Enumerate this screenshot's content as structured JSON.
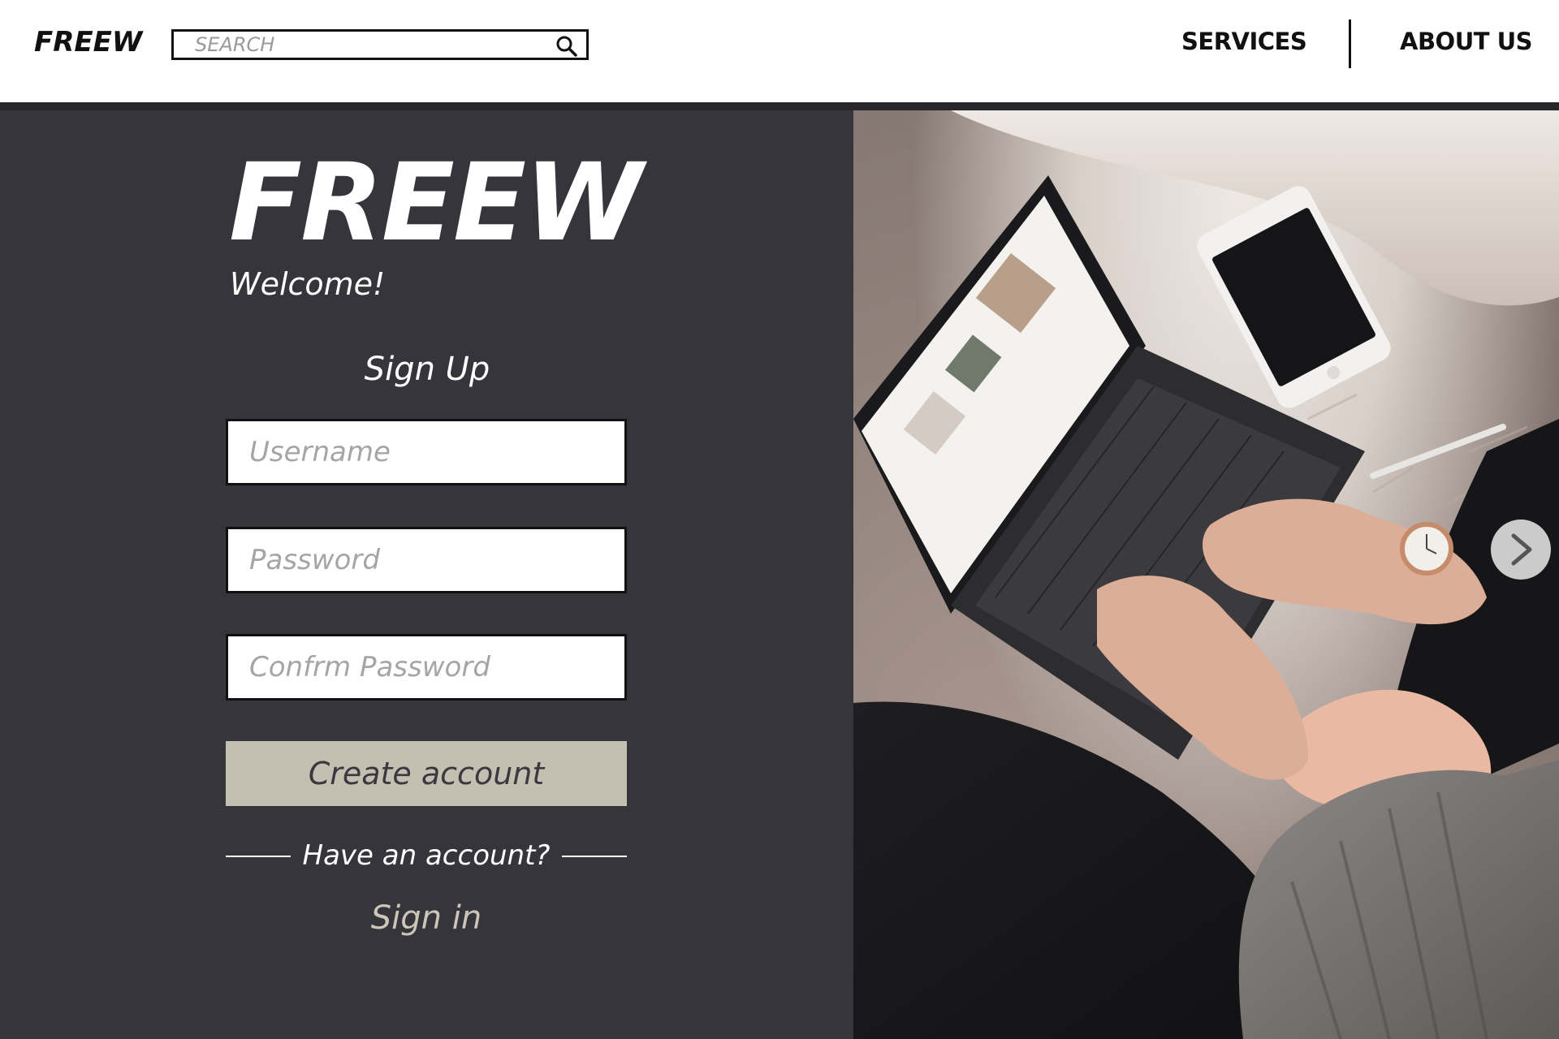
{
  "header": {
    "logo": "FREEW",
    "search": {
      "placeholder": "SEARCH",
      "value": ""
    },
    "nav": [
      "SERVICES",
      "ABOUT US"
    ]
  },
  "form": {
    "brand": "FREEW",
    "welcome": "Welcome!",
    "title": "Sign Up",
    "fields": {
      "username_placeholder": "Username",
      "password_placeholder": "Password",
      "confirm_placeholder": "Confrm Password"
    },
    "create_button": "Create account",
    "have_account": "Have an account?",
    "sign_in": "Sign in"
  },
  "colors": {
    "panel_bg": "#36353c",
    "button_bg": "#c3bfb1",
    "sign_in_text": "#cbc6b8"
  },
  "icons": {
    "search": "search-icon",
    "next": "chevron-right-icon"
  }
}
